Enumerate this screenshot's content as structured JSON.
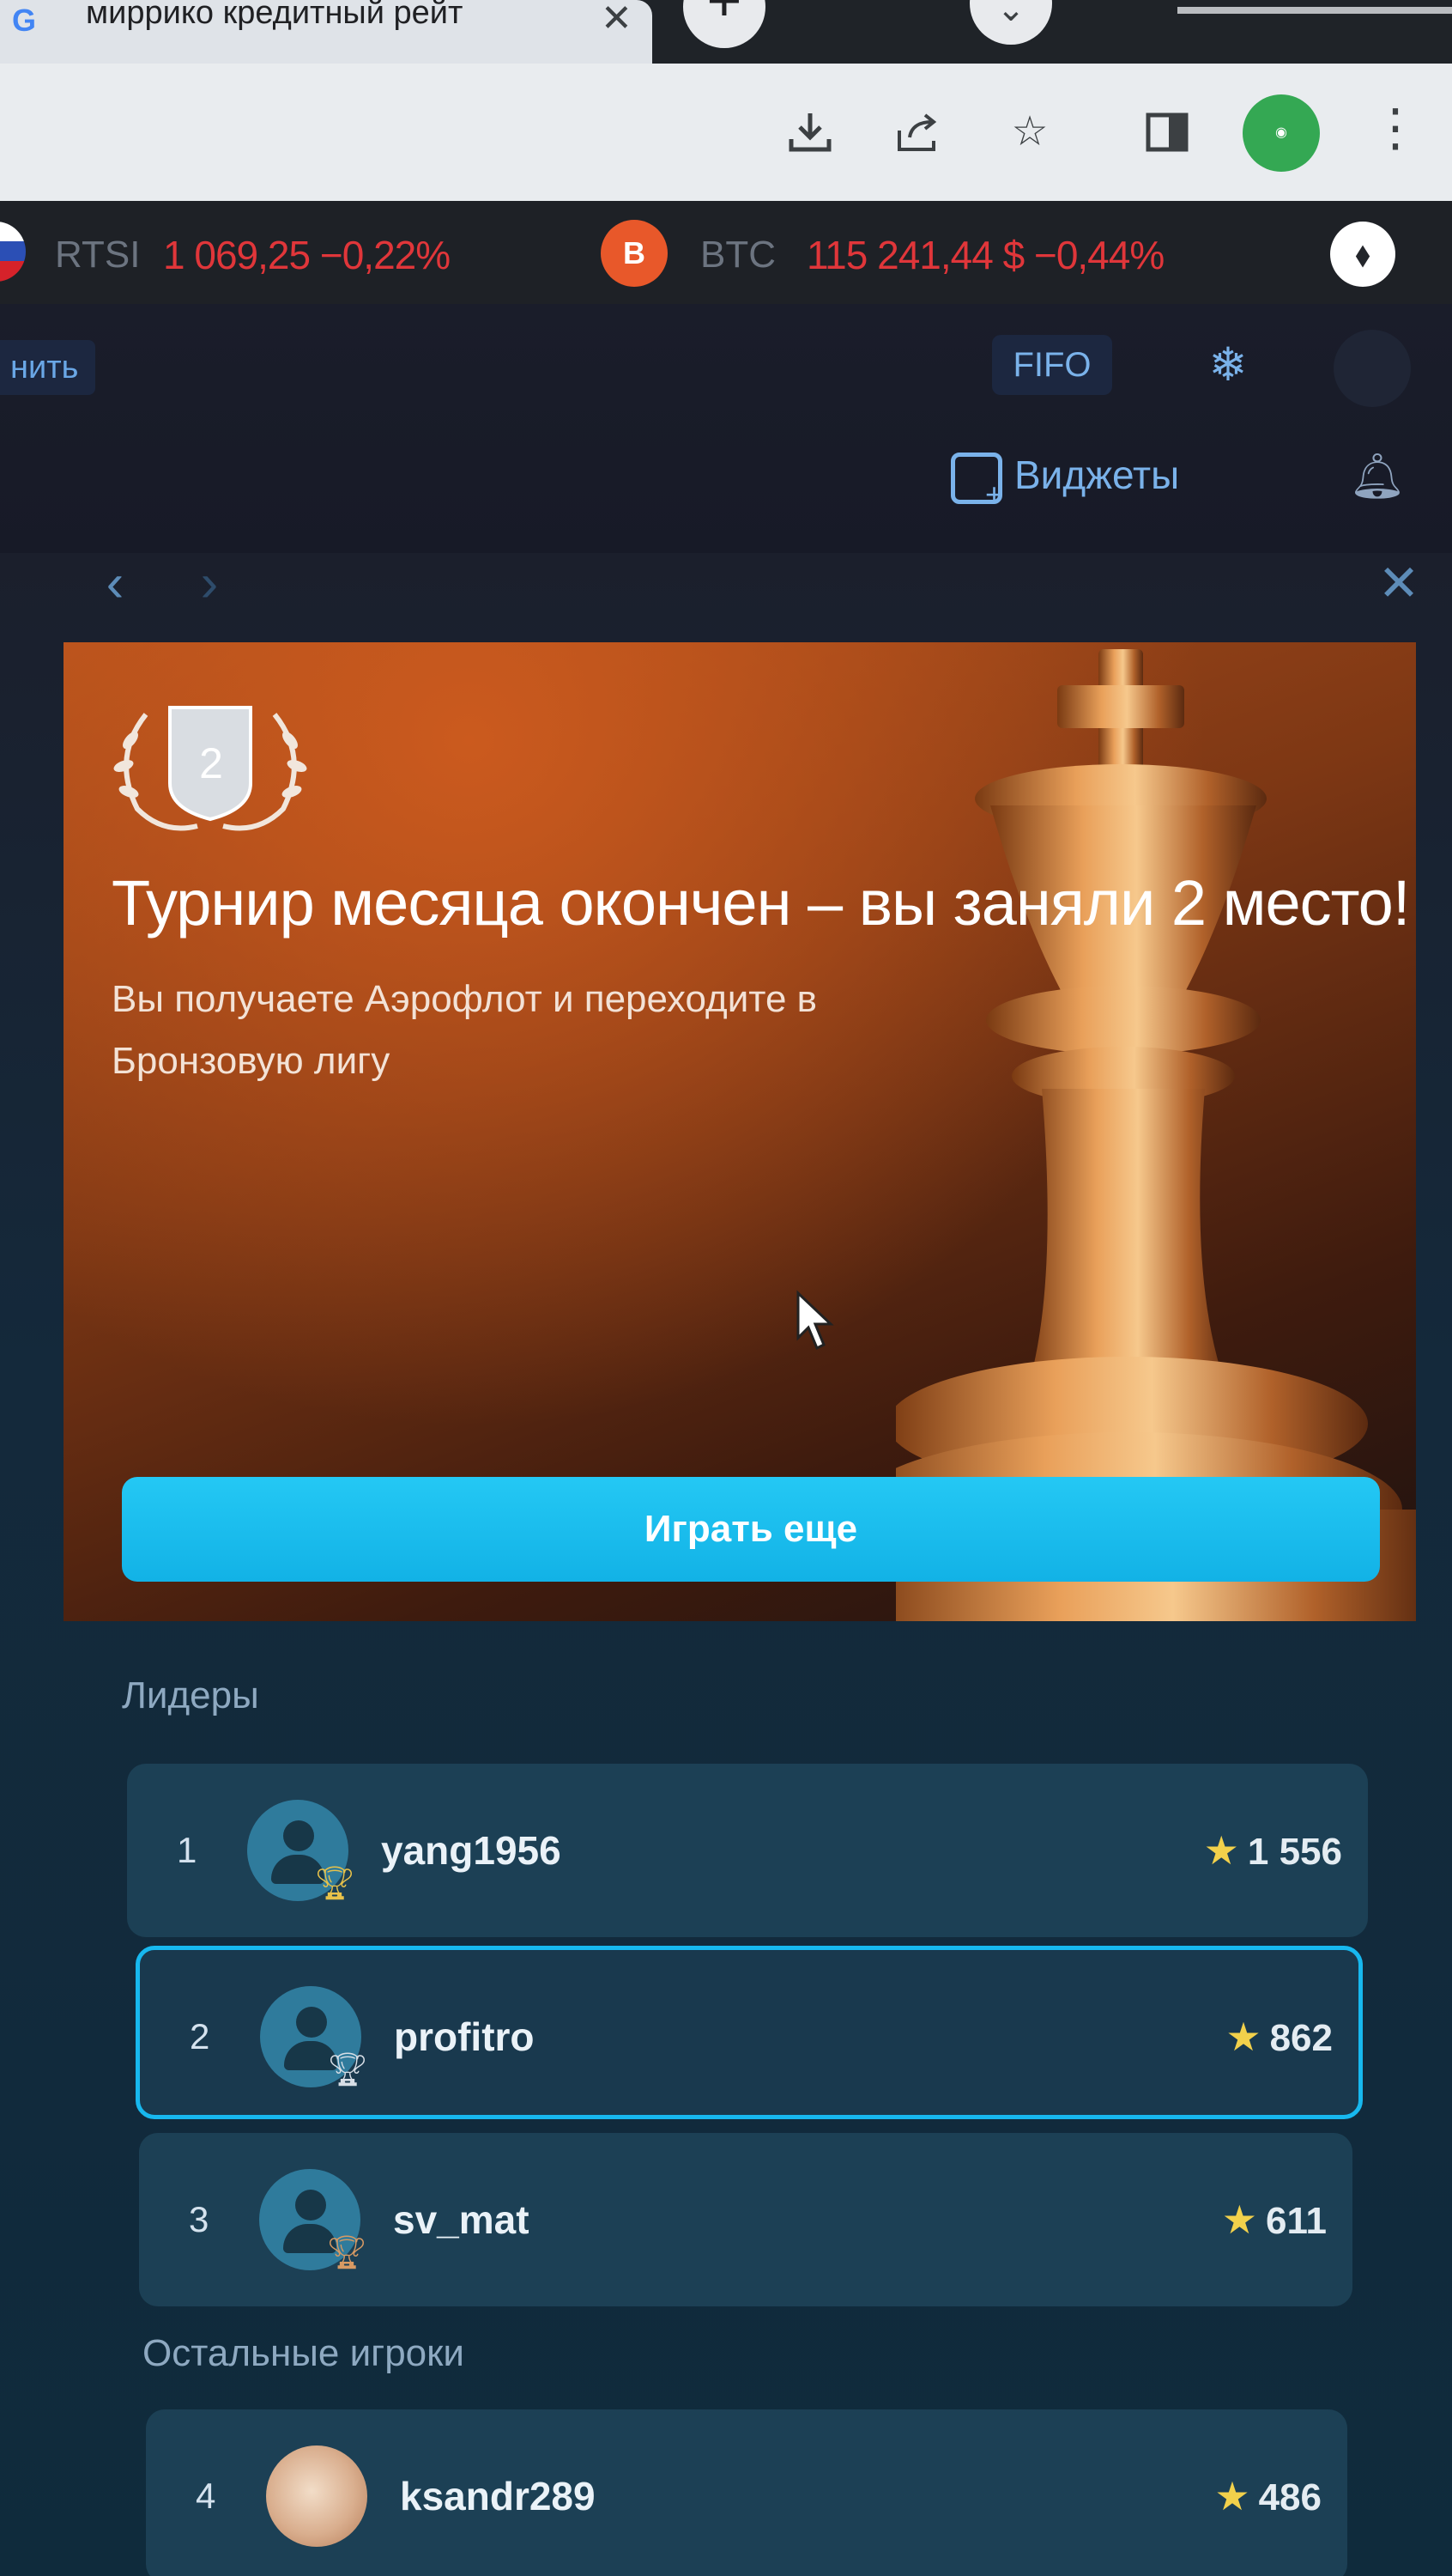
{
  "browser": {
    "tab_title": "миррико кредитный рейт",
    "tab_favicon": "G",
    "tab_close": "✕",
    "new_tab": "+",
    "toolbar_icons": [
      "download-icon",
      "share-icon",
      "star-bookmark-icon",
      "side-panel-icon"
    ],
    "menu": "⋮"
  },
  "ticker": {
    "items": [
      {
        "symbol": "RTSI",
        "value": "1 069,25 −0,22%",
        "flag": "ru-flag-icon"
      },
      {
        "symbol": "BTC",
        "value": "115 241,44 $ −0,44%",
        "badge": "B"
      }
    ],
    "eth_badge": "⬧",
    "negative_color": "#e0363a"
  },
  "header": {
    "left_link": "нить",
    "fifo": "FIFO",
    "widgets": "Виджеты"
  },
  "modal": {
    "place_badge": "2",
    "title": "Турнир месяца окончен – вы заняли 2 место!",
    "subtitle": "Вы получаете Аэрофлот и переходите в Бронзовую лигу",
    "play_button": "Играть еще",
    "accent": "#17b8ef"
  },
  "leaders": {
    "label": "Лидеры",
    "rows": [
      {
        "rank": "1",
        "name": "yang1956",
        "score": "1 556",
        "trophy": "gold"
      },
      {
        "rank": "2",
        "name": "profitro",
        "score": "862",
        "trophy": "silver",
        "current": true
      },
      {
        "rank": "3",
        "name": "sv_mat",
        "score": "611",
        "trophy": "bronze"
      }
    ]
  },
  "others": {
    "label": "Остальные игроки",
    "rows": [
      {
        "rank": "4",
        "name": "ksandr289",
        "score": "486"
      }
    ]
  }
}
